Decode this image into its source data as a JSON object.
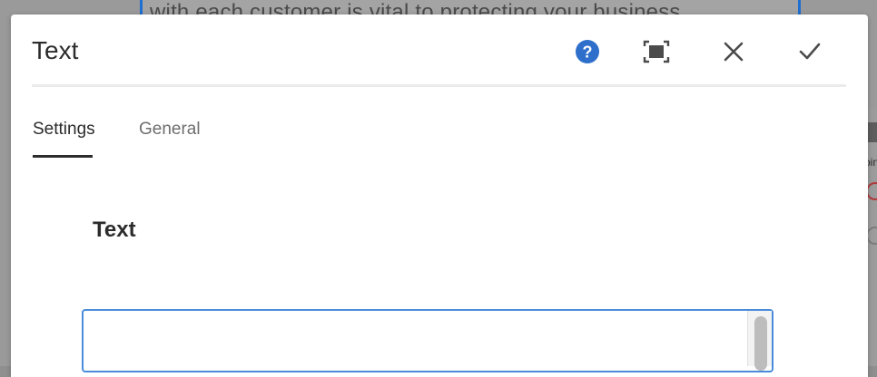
{
  "background": {
    "editable_text": "with each customer is vital to protecting your business",
    "side_text": "oin"
  },
  "dialog": {
    "title": "Text",
    "buttons": {
      "help_icon": "question-circle-icon",
      "fullscreen_icon": "fullscreen-icon",
      "close_icon": "close-icon",
      "done_icon": "checkmark-icon"
    },
    "tabs": [
      {
        "label": "Settings",
        "active": true
      },
      {
        "label": "General",
        "active": false
      }
    ],
    "section_heading": "Text",
    "textarea": {
      "value": "",
      "placeholder": ""
    }
  },
  "colors": {
    "accent": "#2680eb",
    "help_icon": "#2d6fcb",
    "text": "#2c2c2c",
    "tab_inactive": "#6e6e6e",
    "editable_border": "#1f6fd1"
  }
}
